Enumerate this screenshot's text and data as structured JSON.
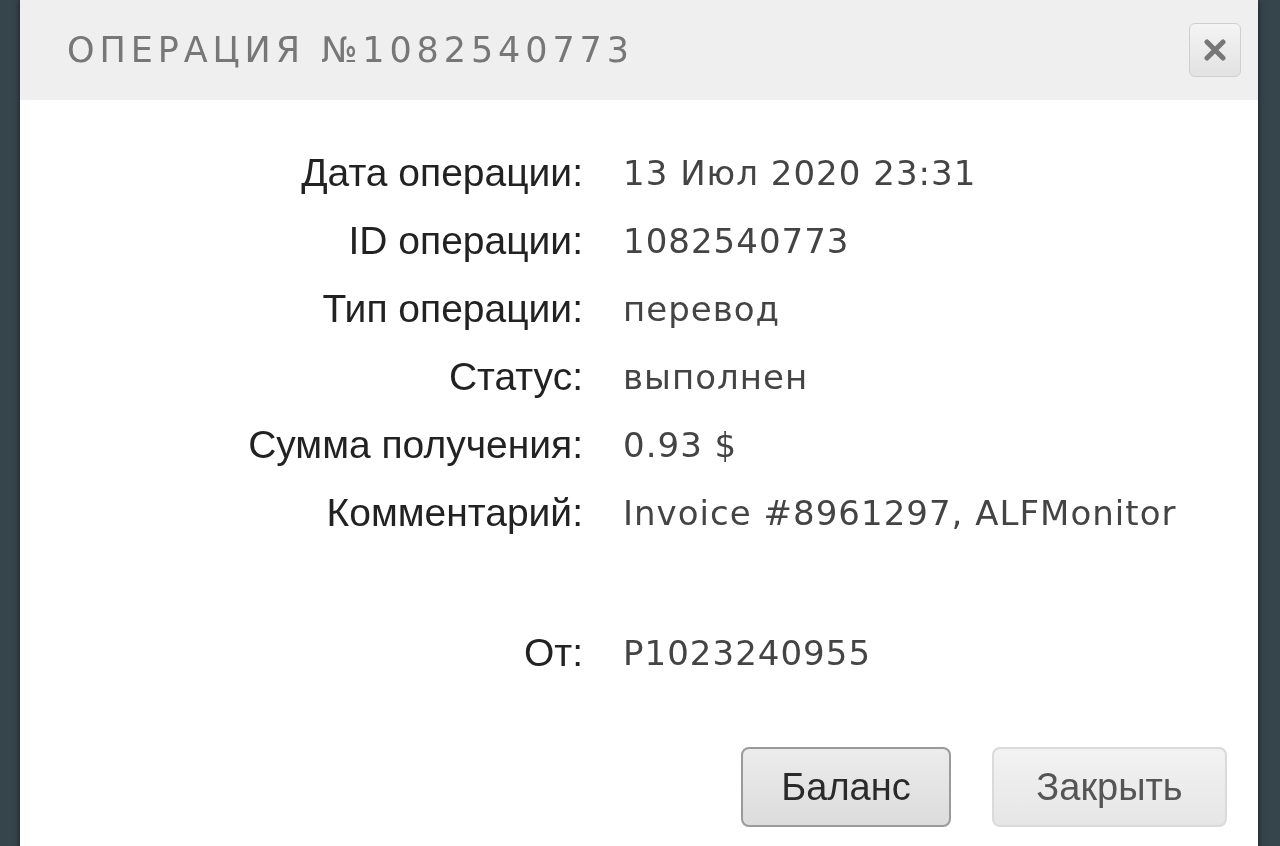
{
  "dialog": {
    "title": "ОПЕРАЦИЯ №1082540773",
    "details": [
      {
        "label": "Дата операции:",
        "value": "13 Июл 2020 23:31"
      },
      {
        "label": "ID операции:",
        "value": "1082540773"
      },
      {
        "label": "Тип операции:",
        "value": "перевод"
      },
      {
        "label": "Статус:",
        "value": "выполнен"
      },
      {
        "label": "Сумма получения:",
        "value": "0.93 $"
      },
      {
        "label": "Комментарий:",
        "value": "Invoice #8961297, ALFMonitor"
      }
    ],
    "sender": {
      "label": "От:",
      "value": "P1023240955"
    },
    "buttons": [
      {
        "label": "Баланс",
        "focused": true
      },
      {
        "label": "Закрыть",
        "focused": false
      }
    ]
  }
}
